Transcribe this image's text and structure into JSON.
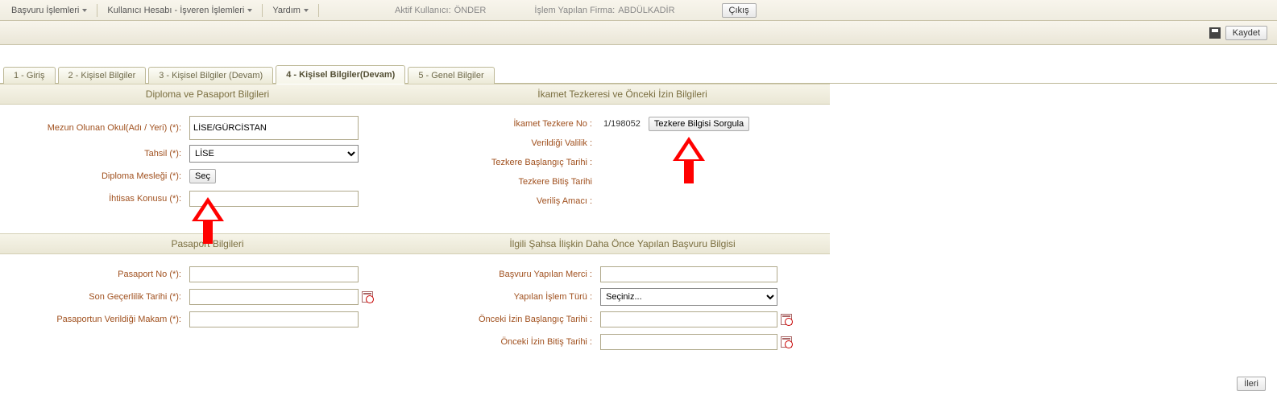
{
  "topbar": {
    "menu": {
      "basvuru": "Başvuru İşlemleri",
      "kullanici": "Kullanıcı Hesabı - İşveren İşlemleri",
      "yardim": "Yardım"
    },
    "aktif_kullanici_label": "Aktif Kullanıcı:",
    "aktif_kullanici_value": "ÖNDER",
    "islem_firma_label": "İşlem Yapılan Firma:",
    "islem_firma_value": "ABDÜLKADİR",
    "cikis": "Çıkış"
  },
  "toolbar": {
    "kaydet": "Kaydet"
  },
  "tabs": {
    "t1": "1 - Giriş",
    "t2": "2 - Kişisel Bilgiler",
    "t3": "3 - Kişisel Bilgiler (Devam)",
    "t4": "4 - Kişisel Bilgiler(Devam)",
    "t5": "5 - Genel Bilgiler"
  },
  "sections": {
    "diploma_header": "Diploma ve Pasaport Bilgileri",
    "ikamet_header": "İkamet Tezkeresi ve Önceki İzin Bilgileri",
    "pasaport_header": "Pasaport Bilgileri",
    "ilgili_header": "İlgili Şahsa İlişkin Daha Önce Yapılan Başvuru Bilgisi"
  },
  "labels": {
    "mezun_okul": "Mezun Olunan Okul(Adı / Yeri) (*):",
    "tahsil": "Tahsil (*):",
    "diploma_meslegi": "Diploma Mesleği (*):",
    "ihtisas_konusu": "İhtisas Konusu (*):",
    "ikamet_no": "İkamet Tezkere No :",
    "verildigi_valilik": "Verildiği Valilik :",
    "tezkere_baslangic": "Tezkere Başlangıç Tarihi :",
    "tezkere_bitis": "Tezkere Bitiş Tarihi",
    "verilis_amaci": "Veriliş Amacı :",
    "pasaport_no": "Pasaport No (*):",
    "son_gecerlilik": "Son Geçerlilik Tarihi (*):",
    "pasaport_makam": "Pasaportun Verildiği Makam (*):",
    "basvuru_merci": "Başvuru Yapılan Merci :",
    "islem_turu": "Yapılan İşlem Türü :",
    "onceki_baslangic": "Önceki İzin Başlangıç Tarihi :",
    "onceki_bitis": "Önceki İzin Bitiş Tarihi :"
  },
  "values": {
    "mezun_okul": "LİSE/GÜRCİSTAN",
    "tahsil_selected": "LİSE",
    "ikamet_no": "1/198052",
    "islem_turu_selected": "Seçiniz...",
    "pasaport_no": "",
    "son_gecerlilik": "",
    "pasaport_makam": "",
    "ihtisas_konusu": "",
    "basvuru_merci": "",
    "onceki_baslangic": "",
    "onceki_bitis": ""
  },
  "buttons": {
    "sec": "Seç",
    "tezkere_sorgula": "Tezkere Bilgisi Sorgula",
    "ileri": "İleri"
  }
}
